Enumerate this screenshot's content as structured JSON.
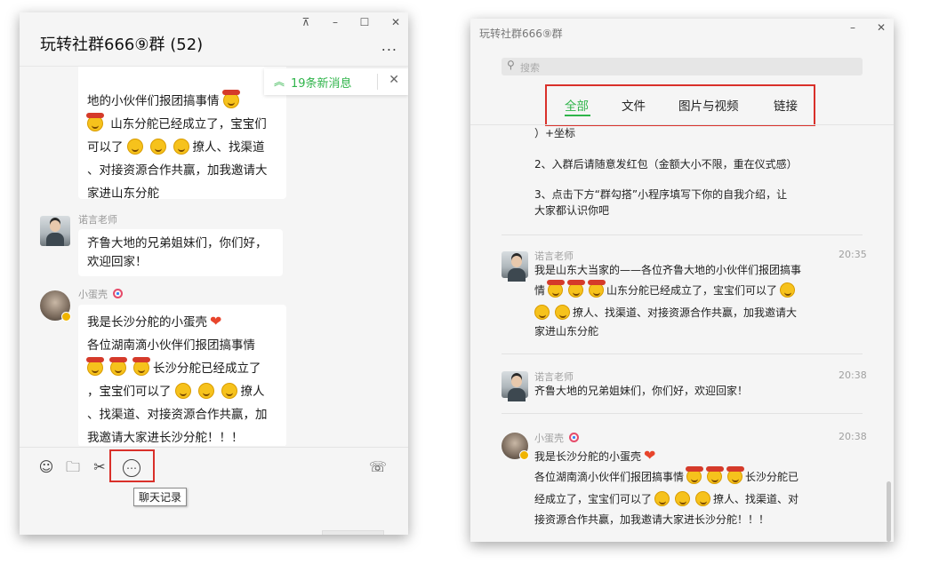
{
  "left_window": {
    "title": "玩转社群666⑨群 (52)",
    "controls": {
      "pin": "⊼",
      "minimize": "–",
      "maximize": "☐",
      "close": "✕"
    },
    "more": "...",
    "new_messages": {
      "arrow": "︽",
      "text": "19条新消息",
      "close": "✕"
    },
    "messages": [
      {
        "lines": [
          "地的小伙伴们报团搞事情",
          "山东分舵已经成立了，宝宝们",
          "可以了",
          "撩人、找渠道",
          "、对接资源合作共赢，加我邀请大",
          "家进山东分舵"
        ]
      },
      {
        "sender": "诺言老师",
        "lines": [
          "齐鲁大地的兄弟姐妹们，你们好，",
          "欢迎回家！"
        ]
      },
      {
        "sender": "小蛋壳",
        "lines": [
          "我是长沙分舵的小蛋壳",
          "各位湖南滴小伙伴们报团搞事情",
          "长沙分舵已经成立了",
          "，宝宝们可以了",
          "撩人",
          "、找渠道、对接资源合作共赢，加",
          "我邀请大家进长沙分舵！！！"
        ]
      }
    ],
    "toolbar": {
      "emoji": "☺",
      "folder": "🗀",
      "scissors": "✂",
      "chat_history": "…",
      "video_call": "☏",
      "tooltip": "聊天记录"
    }
  },
  "right_window": {
    "title": "玩转社群666⑨群",
    "controls": {
      "minimize": "–",
      "close": "✕"
    },
    "search_placeholder": "搜索",
    "search_icon": "⚲",
    "tabs": [
      "全部",
      "文件",
      "图片与视频",
      "链接"
    ],
    "intro_lines": [
      "）+坐标",
      "2、入群后请随意发红包（金额大小不限，重在仪式感）",
      "3、点击下方“群勾搭”小程序填写下你的自我介绍，让",
      "大家都认识你吧"
    ],
    "records": [
      {
        "sender": "诺言老师",
        "time": "20:35",
        "lines": [
          "我是山东大当家的——各位齐鲁大地的小伙伴们报团搞事",
          "情",
          "山东分舵已经成立了，宝宝们可以了",
          "撩人、找渠道、对接资源合作共赢，加我邀请大",
          "家进山东分舵"
        ]
      },
      {
        "sender": "诺言老师",
        "time": "20:38",
        "lines": [
          "齐鲁大地的兄弟姐妹们，你们好，欢迎回家！"
        ]
      },
      {
        "sender": "小蛋壳",
        "time": "20:38",
        "lines": [
          "我是长沙分舵的小蛋壳",
          "各位湖南滴小伙伴们报团搞事情",
          "长沙分舵已",
          "经成立了，宝宝们可以了",
          "撩人、找渠道、对",
          "接资源合作共赢，加我邀请大家进长沙分舵！！！"
        ]
      }
    ]
  },
  "colors": {
    "accent_green": "#2fb44a",
    "highlight_red": "#d9302a"
  },
  "icons": [
    "grin-emoji-icon",
    "devil-emoji-icon",
    "heart-icon",
    "emoji-icon",
    "folder-icon",
    "scissors-icon",
    "chat-history-icon",
    "video-call-icon",
    "search-icon"
  ]
}
